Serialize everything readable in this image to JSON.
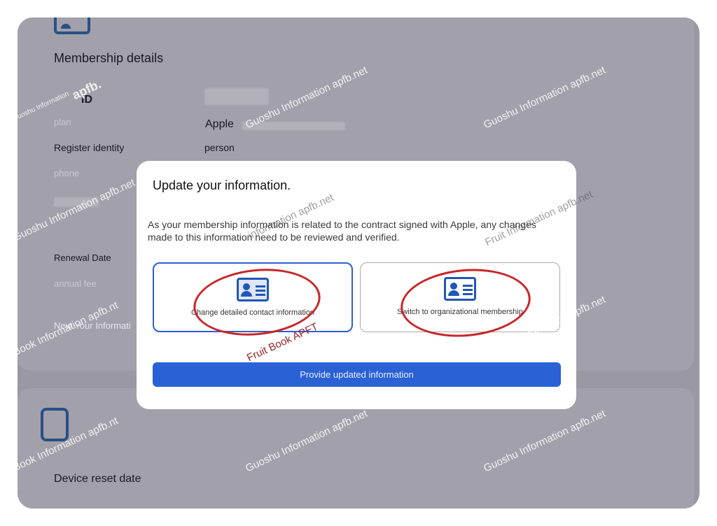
{
  "background_page": {
    "section_title": "Membership details",
    "rows": [
      {
        "label": "ID",
        "value": ""
      },
      {
        "label": "plan",
        "value": "Apple"
      },
      {
        "label": "Register identity",
        "value": "person"
      },
      {
        "label": "phone",
        "value": ""
      },
      {
        "label": "Renewal Date",
        "value": ""
      },
      {
        "label": "annual fee",
        "value": ""
      }
    ],
    "link_text": "New Your Informati",
    "device_section_title": "Device reset date"
  },
  "modal": {
    "title": "Update your information.",
    "description": "As your membership information is related to the contract signed with Apple, any changes made to this information need to be reviewed and verified.",
    "options": [
      {
        "label": "Change detailed contact information",
        "icon": "id-card-icon",
        "selected": true
      },
      {
        "label": "Switch to organizational membership",
        "icon": "id-card-icon",
        "selected": false
      }
    ],
    "primary_button": "Provide updated information"
  },
  "watermarks": [
    "Guoshu Information apfb.net",
    "Guoshu Information apfb.net",
    "Guoshu Information apfb.net",
    "Guoshu Information apfb.net",
    "Guoshu Information apfb.net",
    "Guoshu Information apfb.net",
    "Book Information apfb.nt",
    "Book Information apfb.nt",
    "information apfb.net",
    "Fruit Information apfb.net",
    "Fruit Book APFT",
    "Guoshu Information",
    "apfb."
  ],
  "colors": {
    "accent": "#2a62d6",
    "highlight_ring": "#c8262a",
    "overlay": "#9a98a2"
  }
}
